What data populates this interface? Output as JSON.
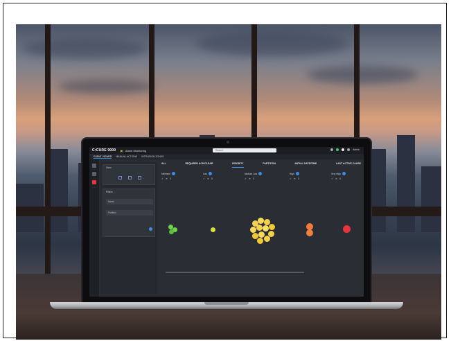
{
  "app": {
    "brand": "C•CURE 9000",
    "module_tag": "[■]",
    "module_name": "Alarm Monitoring",
    "search_placeholder": "Search",
    "user": "Admin"
  },
  "subtabs": [
    {
      "label": "EVENT VIEWER",
      "active": true
    },
    {
      "label": "MANUAL ACTIONS",
      "active": false
    },
    {
      "label": "INTRUSION ZONES",
      "active": false
    }
  ],
  "sidepanel": {
    "view_label": "View",
    "filters_label": "Filters",
    "filter_fields": [
      "Name",
      "Partition"
    ]
  },
  "tabs": [
    {
      "label": "ALL",
      "active": false
    },
    {
      "label": "REQUIRED ACK/CLEAR",
      "active": false
    },
    {
      "label": "PRIORITY",
      "active": true
    },
    {
      "label": "PARTITION",
      "active": false
    },
    {
      "label": "INITIAL DATE/TIME",
      "active": false
    },
    {
      "label": "LAST ACTIVE CAUSE",
      "active": false
    }
  ],
  "priority_columns": [
    {
      "label": "Minimum",
      "count": "3"
    },
    {
      "label": "Low",
      "count": "3"
    },
    {
      "label": "Medium Low",
      "count": "3"
    },
    {
      "label": "High",
      "count": "3"
    },
    {
      "label": "Very High",
      "count": "3"
    }
  ],
  "colors": {
    "accent": "#3a8de4",
    "minimum": "#6fd24a",
    "low": "#d8e03a",
    "medium": "#f5d04a",
    "high": "#f07a3a",
    "very_high": "#e8343c"
  }
}
